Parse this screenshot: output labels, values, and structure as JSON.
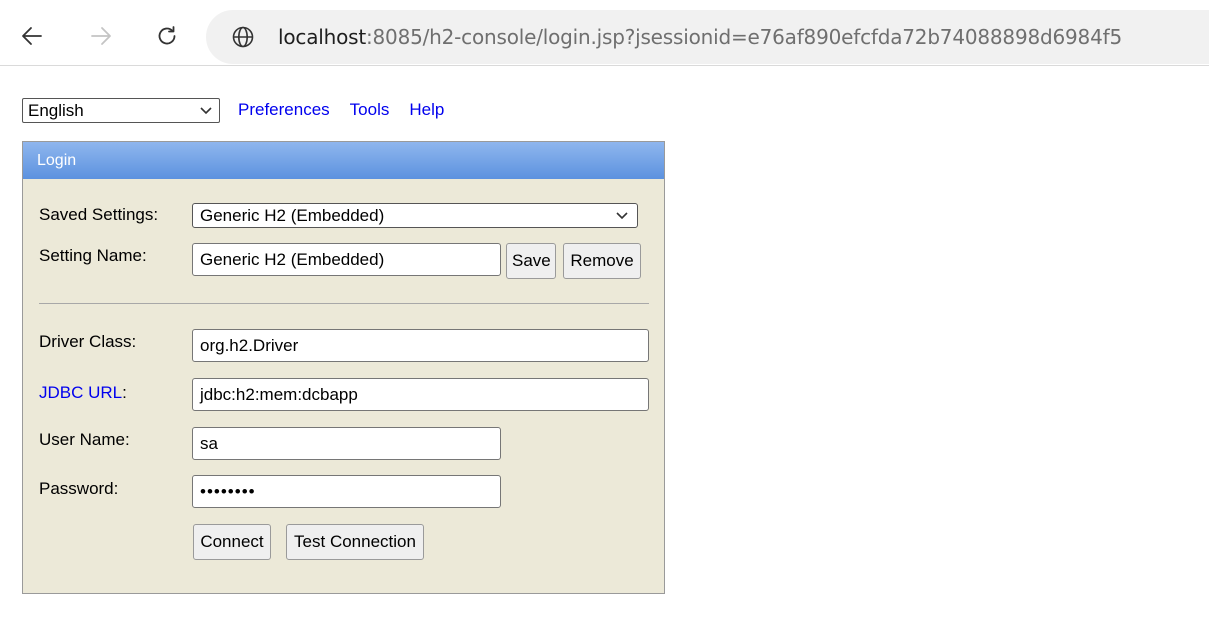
{
  "browser": {
    "url_host": "localhost",
    "url_rest": ":8085/h2-console/login.jsp?jsessionid=e76af890efcfda72b74088898d6984f5"
  },
  "toolbar": {
    "language": "English",
    "links": [
      "Preferences",
      "Tools",
      "Help"
    ]
  },
  "login": {
    "title": "Login",
    "saved_settings_label": "Saved Settings:",
    "saved_settings_value": "Generic H2 (Embedded)",
    "setting_name_label": "Setting Name:",
    "setting_name_value": "Generic H2 (Embedded)",
    "save_label": "Save",
    "remove_label": "Remove",
    "driver_class_label": "Driver Class:",
    "driver_class_value": "org.h2.Driver",
    "jdbc_url_label": "JDBC URL",
    "jdbc_url_colon": ":",
    "jdbc_url_value": "jdbc:h2:mem:dcbapp",
    "user_name_label": "User Name:",
    "user_name_value": "sa",
    "password_label": "Password:",
    "password_value": "••••••••",
    "connect_label": "Connect",
    "test_connection_label": "Test Connection"
  },
  "colors": {
    "panel_bg": "#ece9d8",
    "header_blue": "#5c92df",
    "link_blue": "#0000ee"
  }
}
